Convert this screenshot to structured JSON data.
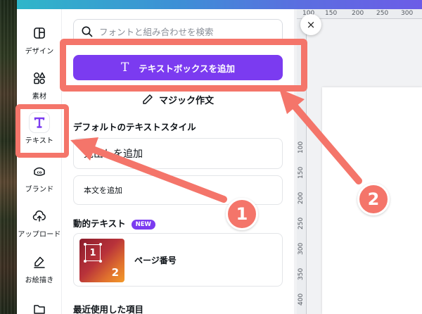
{
  "sidebar": {
    "items": [
      {
        "label": "デザイン",
        "icon": "layout-icon"
      },
      {
        "label": "素材",
        "icon": "elements-icon"
      },
      {
        "label": "テキスト",
        "icon": "text-icon",
        "active": true
      },
      {
        "label": "ブランド",
        "icon": "brand-icon"
      },
      {
        "label": "アップロード",
        "icon": "upload-cloud-icon"
      },
      {
        "label": "お絵描き",
        "icon": "draw-icon"
      },
      {
        "label": "",
        "icon": "folder-icon"
      }
    ]
  },
  "panel": {
    "search_placeholder": "フォントと組み合わせを検索",
    "add_textbox_label": "テキストボックスを追加",
    "add_textbox_glyph": "T",
    "magic_write_label": "マジック作文",
    "default_styles_title": "デフォルトのテキストスタイル",
    "heading_label": "見出しを追加",
    "body_label": "本文を追加",
    "dynamic_title": "動的テキスト",
    "new_badge": "NEW",
    "page_number_label": "ページ番号",
    "thumb_num1": "1",
    "thumb_num2": "2",
    "recent_title": "最近使用した項目"
  },
  "canvas": {
    "ruler_top": [
      "100",
      "150",
      "200",
      "250",
      "300"
    ],
    "ruler_left": [
      "100",
      "150",
      "200",
      "250",
      "300",
      "350",
      "400"
    ],
    "close_icon": "×"
  },
  "annotations": {
    "step1": "1",
    "step2": "2",
    "color": "#f4756a"
  },
  "colors": {
    "accent": "#7b3bf0",
    "annotation": "#f4756a"
  }
}
